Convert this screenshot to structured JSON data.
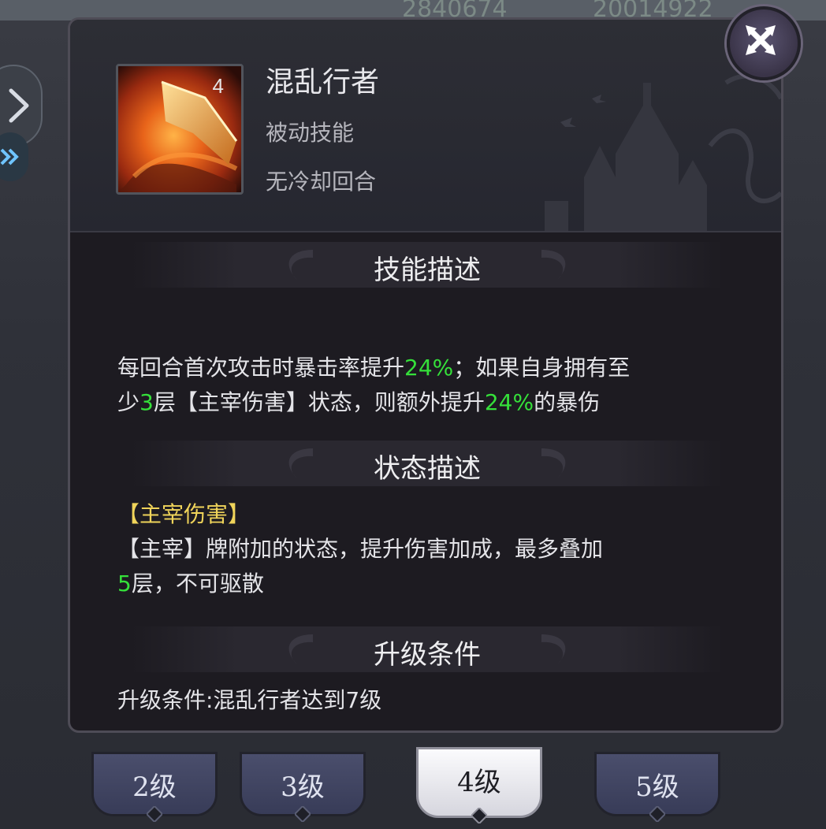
{
  "background": {
    "top_numbers": [
      "2840674",
      "20014922"
    ]
  },
  "skill": {
    "icon_name": "blade-fire-icon",
    "level_badge": "4",
    "name": "混乱行者",
    "type": "被动技能",
    "cooldown": "无冷却回合"
  },
  "sections": {
    "skill_desc_title": "技能描述",
    "status_desc_title": "状态描述",
    "upgrade_title": "升级条件"
  },
  "skill_desc": {
    "line1_a": "每回合首次攻击时暴击率提升",
    "line1_b": "24%",
    "line1_c": "；如果自身拥有至",
    "line2_a": "少",
    "line2_b": "3",
    "line2_c": "层【主宰伤害】状态，则额外提升",
    "line2_d": "24%",
    "line2_e": "的暴伤"
  },
  "status_desc": {
    "name": "【主宰伤害】",
    "line1": "【主宰】牌附加的状态，提升伤害加成，最多叠加",
    "line2_a": "5",
    "line2_b": "层，不可驱散"
  },
  "upgrade": {
    "text": "升级条件:混乱行者达到7级"
  },
  "tabs": [
    {
      "label": "2级",
      "active": false
    },
    {
      "label": "3级",
      "active": false
    },
    {
      "label": "4级",
      "active": true
    },
    {
      "label": "5级",
      "active": false
    }
  ],
  "colors": {
    "highlight_green": "#35e03a",
    "status_gold": "#f0d45a",
    "panel_bg": "#1d1b21"
  }
}
